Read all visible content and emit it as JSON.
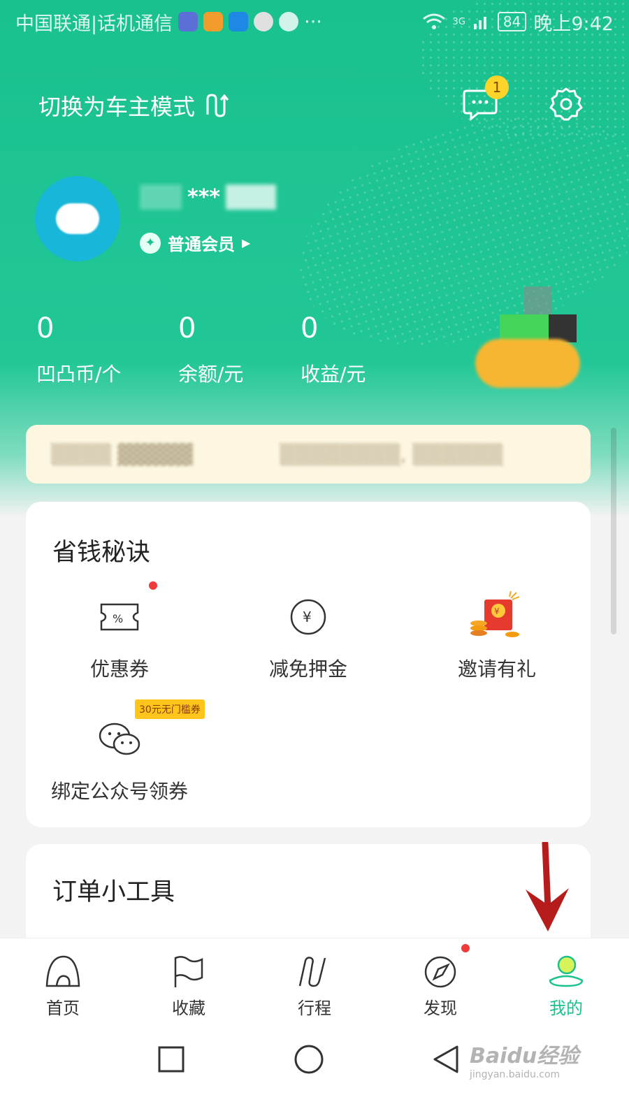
{
  "status_bar": {
    "carrier": "中国联通|话机通信",
    "more": "···",
    "battery": "84",
    "time": "晚上9:42",
    "network": "3G"
  },
  "header": {
    "mode_switch_label": "切换为车主模式",
    "message_badge": "1"
  },
  "profile": {
    "username_masked": "***",
    "member_level": "普通会员"
  },
  "stats": [
    {
      "value": "0",
      "label": "凹凸币/个"
    },
    {
      "value": "0",
      "label": "余额/元"
    },
    {
      "value": "0",
      "label": "收益/元"
    }
  ],
  "money_tips": {
    "title": "省钱秘诀",
    "items": [
      {
        "label": "优惠券",
        "icon": "coupon-icon"
      },
      {
        "label": "减免押金",
        "icon": "yuan-circle-icon"
      },
      {
        "label": "邀请有礼",
        "icon": "red-envelope-icon"
      },
      {
        "label": "绑定公众号领券",
        "icon": "wechat-icon",
        "tag": "30元无门槛券"
      }
    ]
  },
  "order_tools": {
    "title": "订单小工具"
  },
  "bottom_nav": [
    {
      "label": "首页",
      "icon": "home-icon"
    },
    {
      "label": "收藏",
      "icon": "flag-icon"
    },
    {
      "label": "行程",
      "icon": "route-icon"
    },
    {
      "label": "发现",
      "icon": "compass-icon"
    },
    {
      "label": "我的",
      "icon": "profile-icon",
      "active": true
    }
  ],
  "colors": {
    "brand_green": "#19c18f",
    "notice_bg": "#fdf7e2",
    "badge_yellow": "#ffd42a",
    "alert_red": "#ef3b3b"
  },
  "watermark": {
    "brand": "Baidu经验",
    "url": "jingyan.baidu.com"
  }
}
